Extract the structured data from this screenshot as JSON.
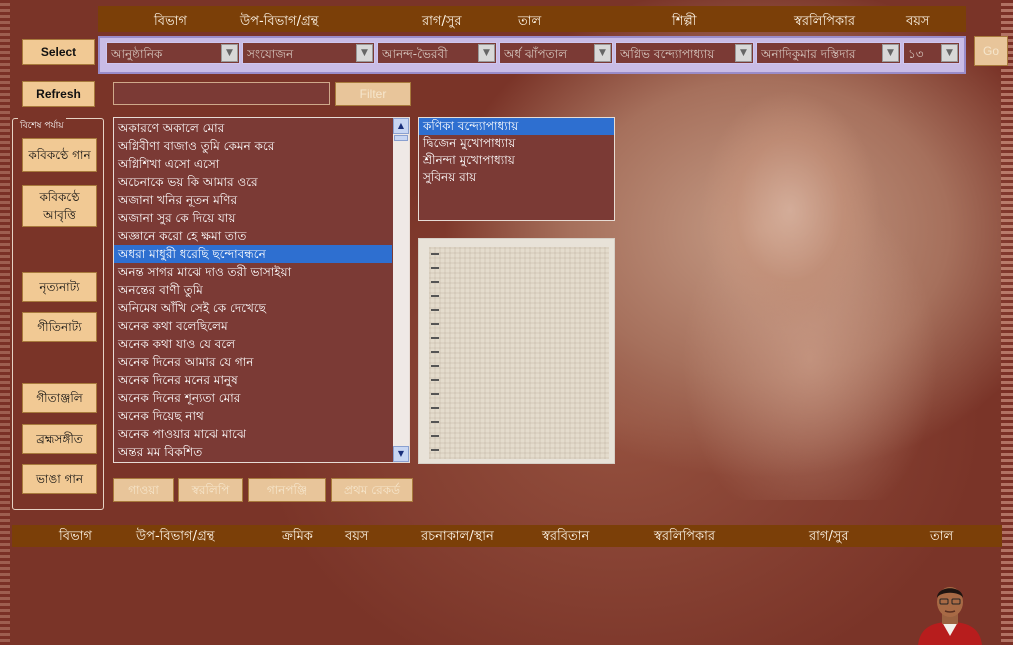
{
  "top_header": [
    "বিভাগ",
    "উপ-বিভাগ/গ্রন্থ",
    "রাগ/সুর",
    "তাল",
    "শিল্পী",
    "স্বরলিপিকার",
    "বয়স"
  ],
  "dropdowns": [
    {
      "value": "আনুষ্ঠানিক"
    },
    {
      "value": "সংযোজন"
    },
    {
      "value": "আনন্দ-ভৈরবী"
    },
    {
      "value": "অর্ধ ঝাঁপতাল"
    },
    {
      "value": "অগ্নিভ বন্দ্যোপাধ্যায়"
    },
    {
      "value": "অনাদিকুমার দস্তিদার"
    },
    {
      "value": "১৩"
    }
  ],
  "buttons": {
    "select": "Select",
    "go": "Go",
    "refresh": "Refresh",
    "filter": "Filter"
  },
  "filter": {
    "value": ""
  },
  "side_group": {
    "legend": "বিশেষ পর্যায়",
    "items": [
      "কবিকণ্ঠে গান",
      "কবিকণ্ঠে আবৃত্তি",
      "নৃত্যনাট্য",
      "গীতিনাট্য",
      "গীতাঞ্জলি",
      "ব্রহ্মসঙ্গীত",
      "ভাঙা গান"
    ]
  },
  "song_list": {
    "items": [
      "অকারণে অকালে মোর",
      "অগ্নিবীণা বাজাও তুমি কেমন করে",
      "অগ্নিশিখা এসো এসো",
      "অচেনাকে ভয় কি আমার ওরে",
      "অজানা খনির নূতন মণির",
      "অজানা সুর কে দিয়ে যায়",
      "অজ্ঞানে করো হে ক্ষমা তাত",
      "অধরা মাধুরী ধরেছি ছন্দোবন্ধনে",
      "অনন্ত সাগর মাঝে দাও তরী ভাসাইয়া",
      "অনন্তের বাণী তুমি",
      "অনিমেষ আঁখি সেই কে দেখেছে",
      "অনেক কথা বলেছিলেম",
      "অনেক কথা যাও যে বলে",
      "অনেক দিনের আমার যে গান",
      "অনেক দিনের মনের মানুষ",
      "অনেক দিনের শূন্যতা মোর",
      "অনেক দিয়েছ নাথ",
      "অনেক পাওয়ার মাঝে মাঝে",
      "অন্তর মম বিকশিত"
    ],
    "selected_index": 7
  },
  "singer_list": {
    "items": [
      "কণিকা বন্দ্যোপাধ্যায়",
      "দ্বিজেন মুখোপাধ্যায়",
      "শ্রীনন্দা মুখোপাধ্যায়",
      "সুবিনয় রায়"
    ],
    "selected_index": 0
  },
  "action_buttons": [
    "গাওয়া",
    "স্বরলিপি",
    "গানপঞ্জি",
    "প্রথম রেকর্ড"
  ],
  "bottom_header": [
    "বিভাগ",
    "উপ-বিভাগ/গ্রন্থ",
    "ক্রমিক",
    "বয়স",
    "রচনাকাল/স্থান",
    "স্বরবিতান",
    "স্বরলিপিকার",
    "রাগ/সুর",
    "তাল"
  ],
  "colors": {
    "header_bg": "#7b3f08",
    "button_bg": "#f1c994",
    "list_bg": "#7b3a35",
    "selection": "#2e6fd0",
    "dropdown_panel": "#c9bce6"
  }
}
